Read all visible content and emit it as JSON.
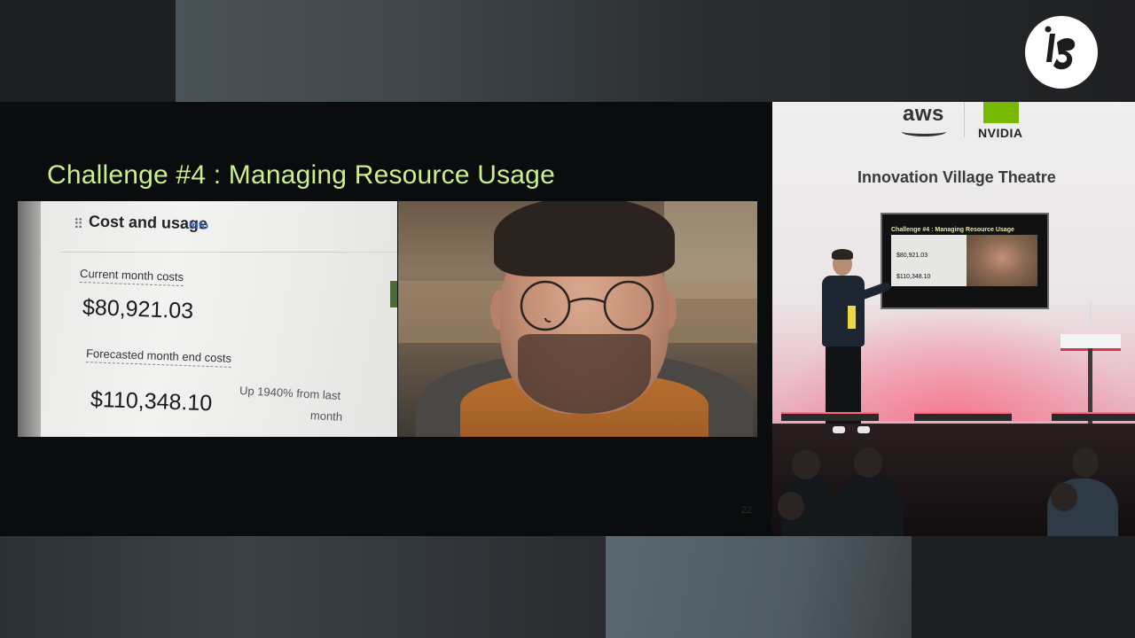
{
  "logo": {
    "name": "IBC",
    "icon": "ibc-logo-icon"
  },
  "slide": {
    "title": "Challenge #4 : Managing Resource Usage",
    "page_number": "22",
    "title_color": "#c9f08c"
  },
  "dashboard": {
    "heading": "Cost and usage",
    "info_link": "Info",
    "current_label": "Current month costs",
    "current_value": "$80,921.03",
    "forecast_label": "Forecasted month end costs",
    "forecast_value": "$110,348.10",
    "change_line1": "Up 1940% from last",
    "change_line2": "month"
  },
  "stage": {
    "sponsor_1": "aws",
    "sponsor_2": "NVIDIA",
    "venue_title": "Innovation Village Theatre",
    "screen": {
      "title": "Challenge #4 : Managing Resource Usage",
      "current_value": "$80,921.03",
      "forecast_value": "$110,348.10"
    }
  }
}
